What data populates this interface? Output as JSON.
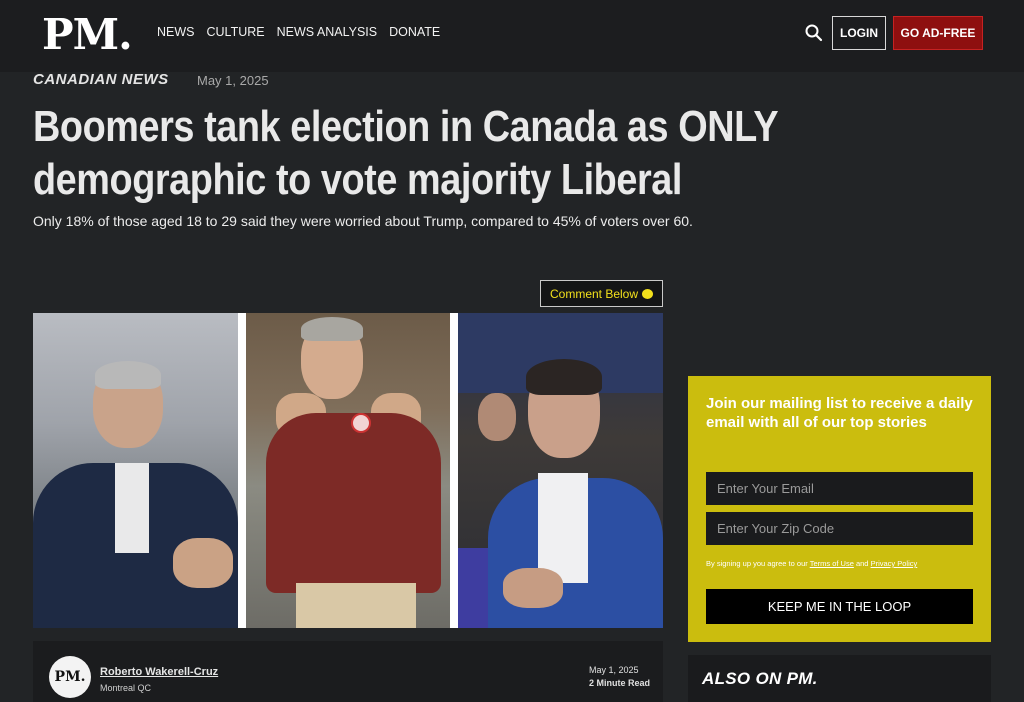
{
  "header": {
    "logo": "PM.",
    "nav": [
      "NEWS",
      "CULTURE",
      "NEWS ANALYSIS",
      "DONATE"
    ],
    "login_label": "LOGIN",
    "adfree_label": "GO AD-FREE",
    "search_icon": "search-icon"
  },
  "article": {
    "category": "CANADIAN NEWS",
    "date": "May 1, 2025",
    "headline": "Boomers tank election in Canada as ONLY demographic to vote majority Liberal",
    "subhead": "Only 18% of those aged 18 to 29 said they were worried about Trump, compared to 45% of voters over 60.",
    "comment_label": "Comment Below",
    "byline": {
      "avatar_text": "PM.",
      "author": "Roberto Wakerell-Cruz",
      "location": "Montreal QC",
      "date": "May 1, 2025",
      "read_time": "2 Minute Read"
    }
  },
  "sidebar": {
    "newsletter": {
      "title": "Join our mailing list to receive a daily email with all of our top stories",
      "email_placeholder": "Enter Your Email",
      "zip_placeholder": "Enter Your Zip Code",
      "terms_prefix": "By signing up you agree to our",
      "terms_link": "Terms of Use",
      "terms_and": "and",
      "privacy_link": "Privacy Policy",
      "submit_label": "KEEP ME IN THE LOOP"
    },
    "also_title": "ALSO ON PM."
  },
  "colors": {
    "background": "#222426",
    "topbar": "#1c1d1f",
    "adfree": "#8e0f0f",
    "newsletter": "#cbbd0e",
    "comment_accent": "#f2e01c"
  }
}
